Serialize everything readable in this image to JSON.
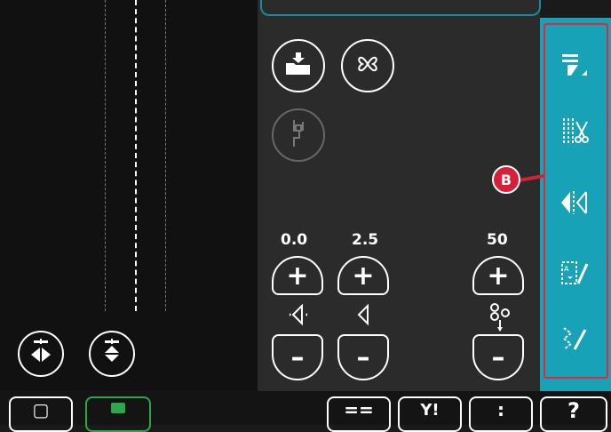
{
  "left_panel": {
    "mirror_side_icon": "mirror-side-to-side-icon",
    "mirror_end_icon": "mirror-end-to-end-icon"
  },
  "controls": {
    "load_icon": "load-stitch-folder-icon",
    "shape_icon": "stitch-shaping-icon",
    "presser_icon": "presser-foot-icon",
    "stitch_width": {
      "value": "0.0",
      "icon": "stitch-width-icon"
    },
    "stitch_length": {
      "value": "2.5",
      "icon": "stitch-length-icon"
    },
    "density": {
      "value": "50",
      "icon": "stitch-density-icon"
    },
    "plus": "+",
    "minus": "–"
  },
  "sidebar": {
    "items": [
      {
        "icon": "stitch-menu-icon"
      },
      {
        "icon": "thread-cutter-icon"
      },
      {
        "icon": "mirror-width-icon"
      },
      {
        "icon": "stitch-techniques-icon"
      },
      {
        "icon": "stitch-program-icon"
      }
    ]
  },
  "callout": {
    "label": "B"
  },
  "bottom_bar": {
    "buttons": [
      {
        "label": "▢",
        "icon": "embroidery-mode-icon"
      },
      {
        "label": "",
        "icon": "sewing-mode-icon",
        "active": true
      },
      {
        "label": "==",
        "icon": "menu-list-icon"
      },
      {
        "label": "Y!",
        "icon": "settings-icon"
      },
      {
        "label": ":",
        "icon": "info-icon"
      },
      {
        "label": "?",
        "icon": "help-icon"
      }
    ]
  },
  "colors": {
    "accent": "#18a2b8",
    "callout": "#d81f3a",
    "active_green": "#2aa84a"
  }
}
